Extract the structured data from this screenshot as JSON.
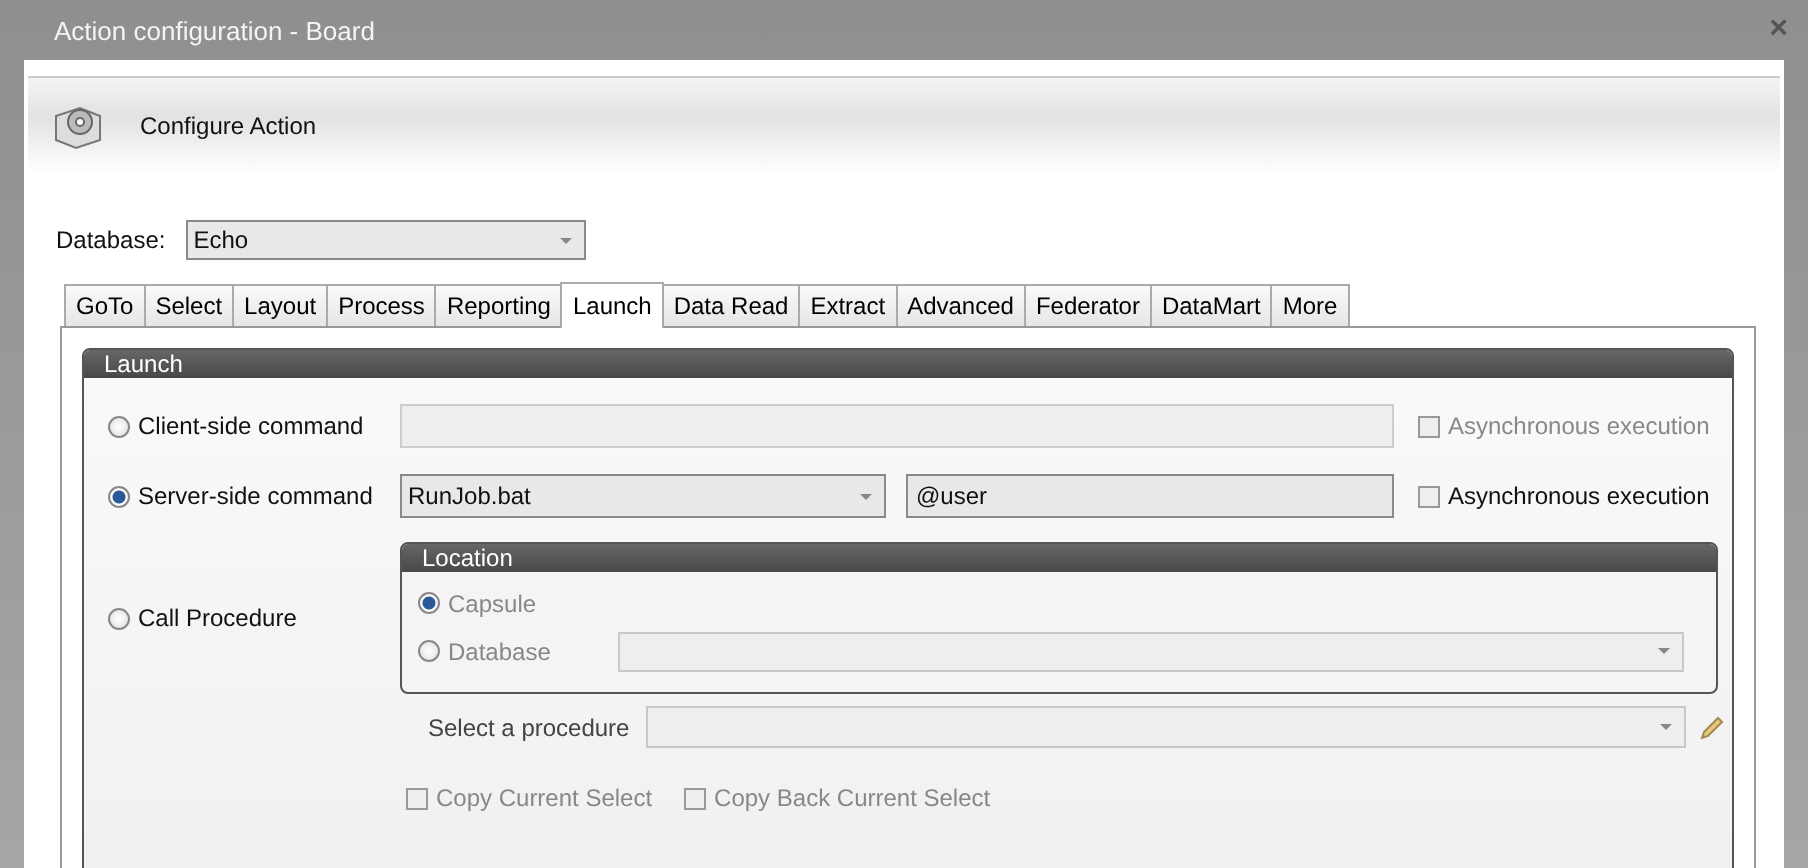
{
  "window": {
    "title": "Action configuration - Board",
    "close": "×"
  },
  "header": {
    "title": "Configure Action"
  },
  "database": {
    "label": "Database:",
    "value": "Echo"
  },
  "tabs": [
    {
      "label": "GoTo",
      "selected": false
    },
    {
      "label": "Select",
      "selected": false
    },
    {
      "label": "Layout",
      "selected": false
    },
    {
      "label": "Process",
      "selected": false
    },
    {
      "label": "Reporting",
      "selected": false
    },
    {
      "label": "Launch",
      "selected": true
    },
    {
      "label": "Data Read",
      "selected": false
    },
    {
      "label": "Extract",
      "selected": false
    },
    {
      "label": "Advanced",
      "selected": false
    },
    {
      "label": "Federator",
      "selected": false
    },
    {
      "label": "DataMart",
      "selected": false
    },
    {
      "label": "More",
      "selected": false
    }
  ],
  "launch": {
    "title": "Launch",
    "client": {
      "label": "Client-side command",
      "selected": false,
      "async": {
        "label": "Asynchronous execution",
        "checked": false,
        "disabled": true
      }
    },
    "server": {
      "label": "Server-side command",
      "selected": true,
      "command": "RunJob.bat",
      "argument": "@user",
      "async": {
        "label": "Asynchronous execution",
        "checked": false,
        "disabled": false
      }
    },
    "procedure": {
      "label": "Call Procedure",
      "selected": false,
      "location": {
        "title": "Location",
        "options": [
          {
            "label": "Capsule",
            "selected": true
          },
          {
            "label": "Database",
            "selected": false
          }
        ]
      },
      "select_label": "Select a procedure",
      "copy_options": [
        {
          "label": "Copy Current Select",
          "checked": false
        },
        {
          "label": "Copy Back Current Select",
          "checked": false
        }
      ]
    }
  }
}
